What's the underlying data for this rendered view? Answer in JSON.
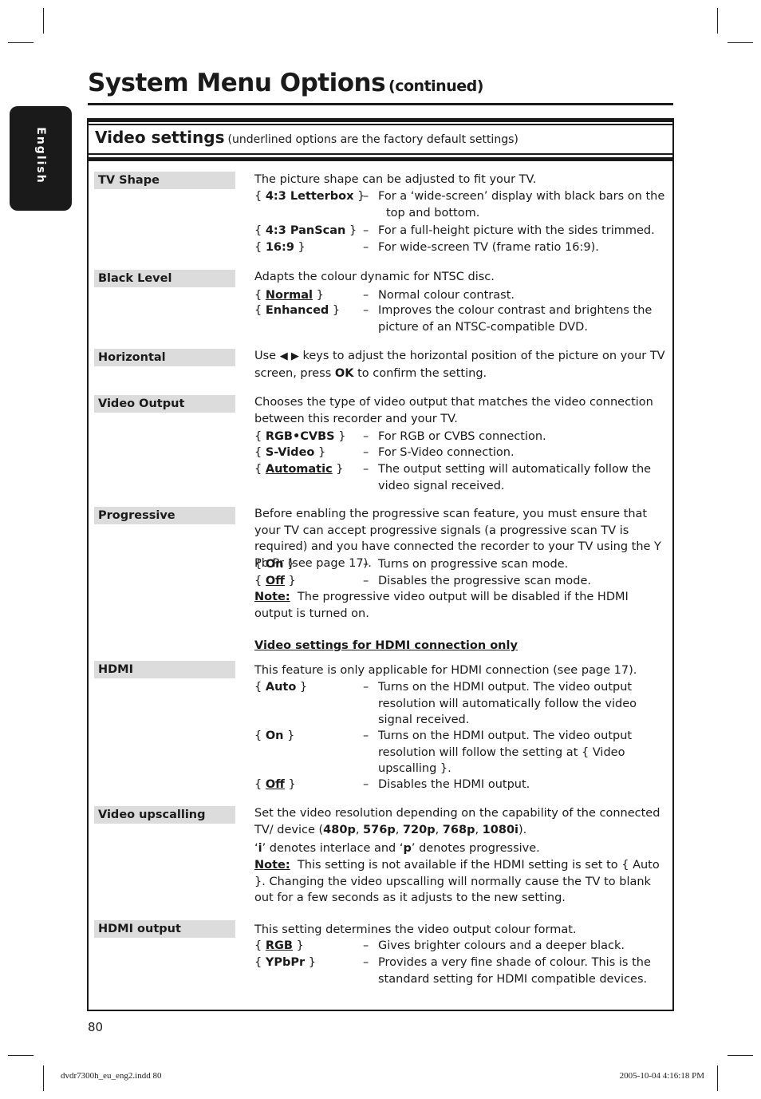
{
  "page": {
    "title": "System Menu Options",
    "title_suffix": "(continued)",
    "language_tab": "English",
    "page_number": "80",
    "footer_left": "dvdr7300h_eu_eng2.indd   80",
    "footer_right": "2005-10-04   4:16:18 PM"
  },
  "section": {
    "heading": "Video settings",
    "subheading": "(underlined options are the factory default settings)"
  },
  "settings": [
    {
      "label": "TV Shape",
      "intro": "The picture shape can be adjusted to fit your TV.",
      "options": [
        {
          "name": "4:3 Letterbox",
          "default": false,
          "desc": "For a ‘wide-screen’ display with black bars on the top and bottom."
        },
        {
          "name": "4:3 PanScan",
          "default": false,
          "desc": "For a full-height picture with the sides trimmed."
        },
        {
          "name": "16:9",
          "default": false,
          "desc": "For wide-screen TV (frame ratio 16:9)."
        }
      ]
    },
    {
      "label": "Black Level",
      "intro": "Adapts the colour dynamic for NTSC disc.",
      "options": [
        {
          "name": "Normal",
          "default": true,
          "desc": "Normal colour contrast."
        },
        {
          "name": "Enhanced",
          "default": false,
          "desc": "Improves the colour contrast and brightens the picture of an NTSC-compatible DVD."
        }
      ]
    },
    {
      "label": "Horizontal",
      "intro_parts": [
        "Use",
        "◀ ▶",
        "keys to adjust the horizontal position of the picture on your TV screen, press",
        "OK",
        "to confirm the setting."
      ]
    },
    {
      "label": "Video Output",
      "intro": "Chooses the type of video output that matches the video connection between this recorder and your TV.",
      "options": [
        {
          "name": "RGB•CVBS",
          "default": false,
          "desc": "For RGB or CVBS connection."
        },
        {
          "name": "S-Video",
          "default": false,
          "desc": "For S-Video connection."
        },
        {
          "name": "Automatic",
          "default": true,
          "desc": "The output setting will automatically follow the video signal received."
        }
      ]
    },
    {
      "label": "Progressive",
      "intro": "Before enabling the progressive scan feature, you must ensure that your TV can accept progressive signals (a progressive scan TV is required) and you have connected the recorder to your TV using the Y Pb Pr (see page 17).",
      "options": [
        {
          "name": "On",
          "default": false,
          "desc": "Turns on progressive scan mode."
        },
        {
          "name": "Off",
          "default": true,
          "desc": "Disables the progressive scan mode."
        }
      ],
      "note_label": "Note:",
      "note": "The progressive video output will be disabled if the HDMI output is turned on."
    },
    {
      "subsection_heading": "Video settings for HDMI connection only"
    },
    {
      "label": "HDMI",
      "intro": "This feature is only applicable for HDMI connection (see page 17).",
      "options": [
        {
          "name": "Auto",
          "default": false,
          "desc": "Turns on the HDMI output.  The video output resolution will automatically follow the video signal received."
        },
        {
          "name": "On",
          "default": false,
          "desc": "Turns on the HDMI output. The video output resolution will follow the setting at { Video upscalling }."
        },
        {
          "name": "Off",
          "default": true,
          "desc": "Disables the HDMI output."
        }
      ]
    },
    {
      "label": "Video upscalling",
      "intro_pre": "Set the video resolution depending on the capability of the connected TV/ device (",
      "resolutions": [
        "480p",
        "576p",
        "720p",
        "768p",
        "1080i"
      ],
      "intro_post": ").",
      "legend_i": "i",
      "legend_i_text": "’ denotes interlace and ‘",
      "legend_p": "p",
      "legend_p_text": "’ denotes progressive.",
      "note_label": "Note:",
      "note": "This setting is not available if the HDMI setting is set to { Auto }. Changing the video upscalling will normally cause the TV to blank out for a few seconds as it adjusts to the new setting."
    },
    {
      "label": "HDMI output",
      "intro": "This setting determines the video output colour format.",
      "options": [
        {
          "name": "RGB",
          "default": true,
          "desc": "Gives brighter colours and a deeper black."
        },
        {
          "name": "YPbPr",
          "default": false,
          "desc": "Provides a very fine shade of colour.  This is the standard setting for HDMI compatible devices."
        }
      ]
    }
  ],
  "dash": "–"
}
